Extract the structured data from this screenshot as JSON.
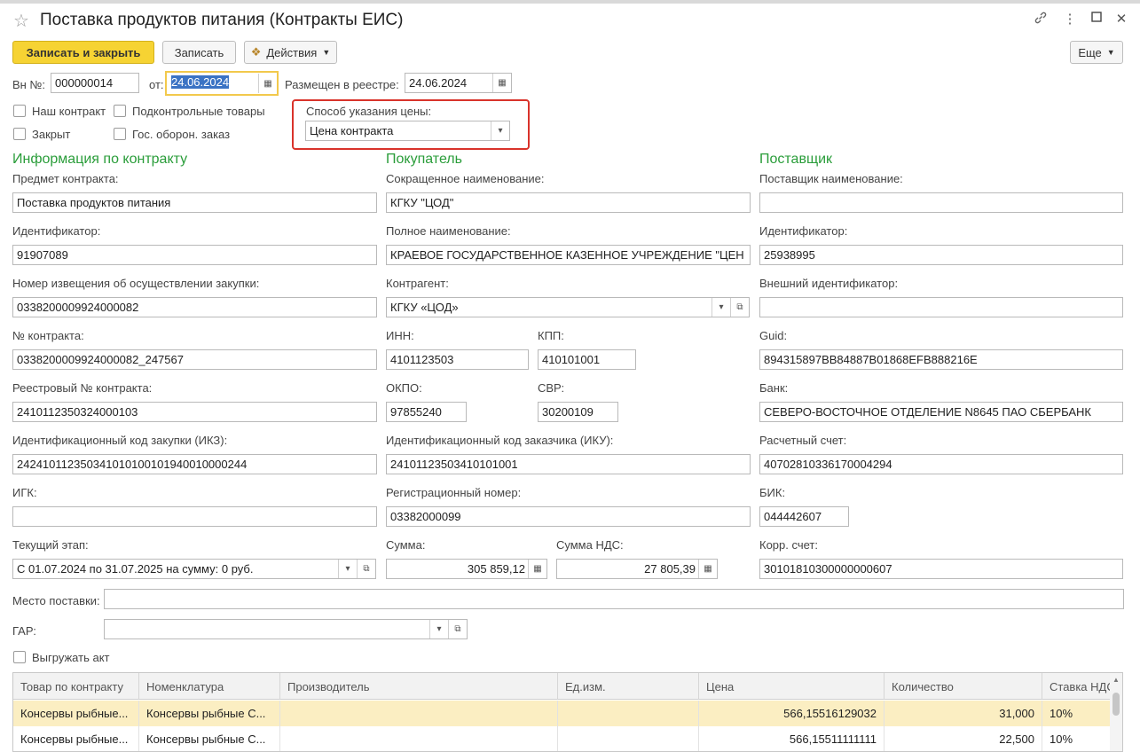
{
  "window": {
    "title": "Поставка продуктов питания (Контракты ЕИС)"
  },
  "icons": {
    "favorite": "star-icon",
    "link": "link-icon",
    "more": "more-vertical-icon",
    "maximize": "maximize-icon",
    "close": "close-icon"
  },
  "toolbar": {
    "save_close": "Записать и закрыть",
    "save": "Записать",
    "actions": "Действия",
    "more": "Еще"
  },
  "header": {
    "vn_label": "Вн №:",
    "vn_value": "000000014",
    "from_label": "от:",
    "from_value": "24.06.2024",
    "registry_label": "Размещен в реестре:",
    "registry_value": "24.06.2024",
    "our_contract": "Наш контракт",
    "controlled_goods": "Подконтрольные товары",
    "closed": "Закрыт",
    "defense_order": "Гос. оборон. заказ",
    "price_method_label": "Способ указания цены:",
    "price_method_value": "Цена контракта"
  },
  "contract": {
    "section": "Информация по контракту",
    "subject_label": "Предмет контракта:",
    "subject_value": "Поставка продуктов питания",
    "id_label": "Идентификатор:",
    "id_value": "91907089",
    "notice_label": "Номер извещения об осуществлении закупки:",
    "notice_value": "0338200009924000082",
    "number_label": "№ контракта:",
    "number_value": "0338200009924000082_247567",
    "registry_no_label": "Реестровый № контракта:",
    "registry_no_value": "2410112350324000103",
    "ikz_label": "Идентификационный код закупки (ИКЗ):",
    "ikz_value": "242410112350341010100101940010000244",
    "igk_label": "ИГК:",
    "igk_value": "",
    "stage_label": "Текущий этап:",
    "stage_value": "С 01.07.2024 по 31.07.2025 на сумму: 0 руб."
  },
  "buyer": {
    "section": "Покупатель",
    "short_label": "Сокращенное наименование:",
    "short_value": "КГКУ \"ЦОД\"",
    "full_label": "Полное наименование:",
    "full_value": "КРАЕВОЕ ГОСУДАРСТВЕННОЕ КАЗЕННОЕ УЧРЕЖДЕНИЕ \"ЦЕН",
    "counterparty_label": "Контрагент:",
    "counterparty_value": "КГКУ «ЦОД»",
    "inn_label": "ИНН:",
    "inn_value": "4101123503",
    "kpp_label": "КПП:",
    "kpp_value": "410101001",
    "okpo_label": "ОКПО:",
    "okpo_value": "97855240",
    "svr_label": "СВР:",
    "svr_value": "30200109",
    "iku_label": "Идентификационный код заказчика (ИКУ):",
    "iku_value": "241011235034101010​01",
    "reg_label": "Регистрационный номер:",
    "reg_value": "03382000099",
    "sum_label": "Сумма:",
    "sum_value": "305 859,12",
    "vat_label": "Сумма НДС:",
    "vat_value": "27 805,39"
  },
  "supplier": {
    "section": "Поставщик",
    "name_label": "Поставщик наименование:",
    "name_value": "",
    "id_label": "Идентификатор:",
    "id_value": "25938995",
    "ext_label": "Внешний идентификатор:",
    "ext_value": "",
    "guid_label": "Guid:",
    "guid_value": "894315897BB84887B01868EFB888216E",
    "bank_label": "Банк:",
    "bank_value": "СЕВЕРО-ВОСТОЧНОЕ ОТДЕЛЕНИЕ N8645 ПАО СБЕРБАНК",
    "account_label": "Расчетный счет:",
    "account_value": "40702810336170004294",
    "bik_label": "БИК:",
    "bik_value": "044442607",
    "corr_label": "Корр. счет:",
    "corr_value": "30101810300000000607"
  },
  "delivery": {
    "place_label": "Место поставки:",
    "place_value": "",
    "gar_label": "ГАР:",
    "gar_value": "",
    "export_act": "Выгружать акт"
  },
  "table": {
    "headers": [
      "Товар по контракту",
      "Номенклатура",
      "Производитель",
      "Ед.изм.",
      "Цена",
      "Количество",
      "Ставка НДС"
    ],
    "rows": [
      [
        "Консервы рыбные...",
        "Консервы рыбные С...",
        "",
        "",
        "566,15516129032",
        "31,000",
        "10%"
      ],
      [
        "Консервы рыбные...",
        "Консервы рыбные С...",
        "",
        "",
        "566,15511111111",
        "22,500",
        "10%"
      ]
    ]
  }
}
